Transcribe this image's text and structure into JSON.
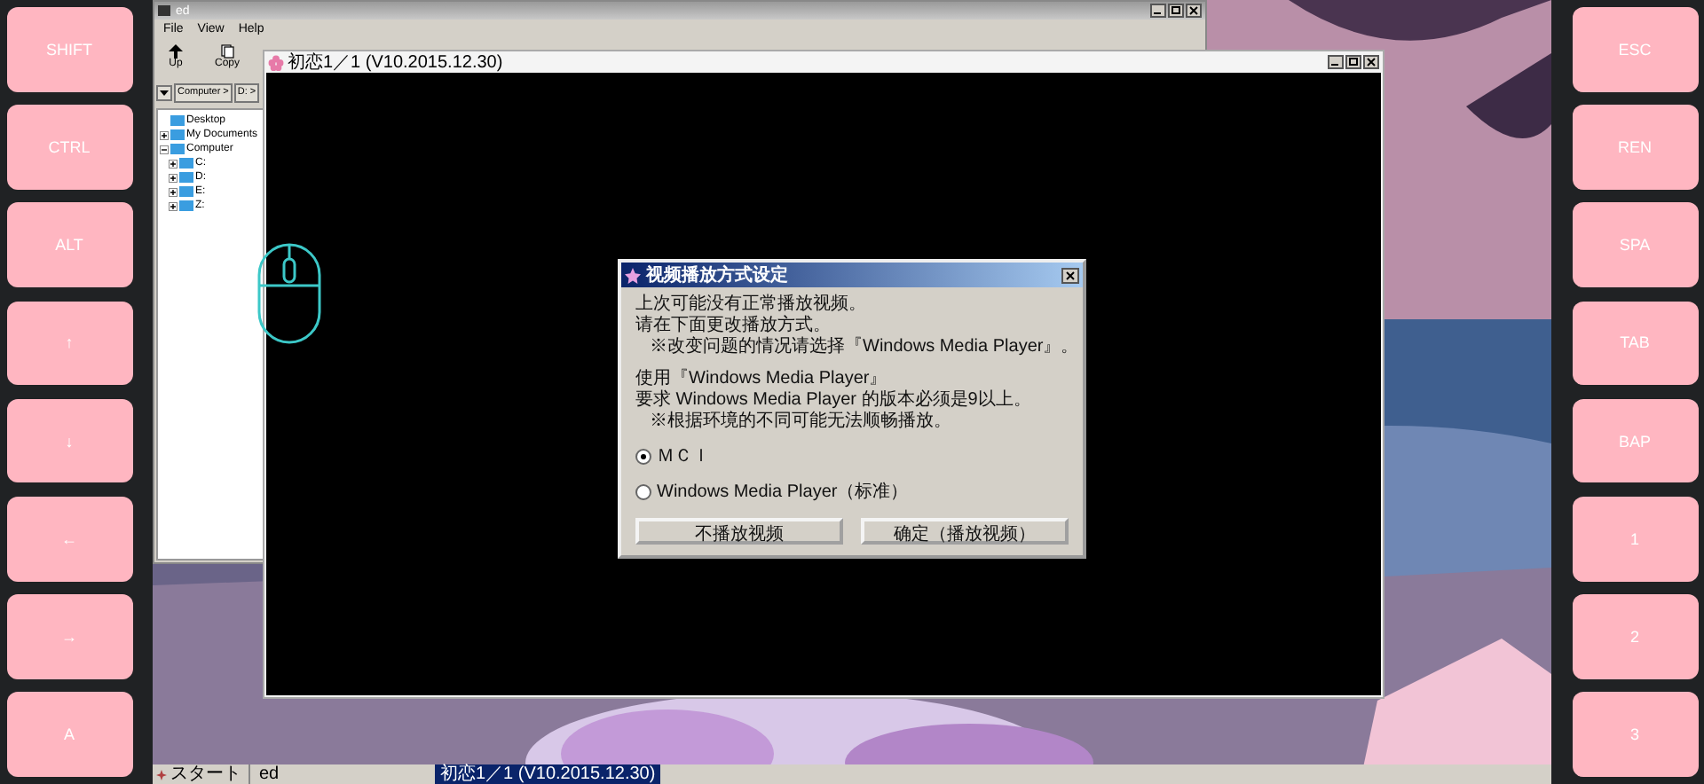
{
  "keys_left": [
    {
      "label": "SHIFT"
    },
    {
      "label": "CTRL"
    },
    {
      "label": "ALT"
    },
    {
      "label": "↑"
    },
    {
      "label": "↓"
    },
    {
      "label": "←"
    },
    {
      "label": "→"
    },
    {
      "label": "A"
    }
  ],
  "keys_right": [
    {
      "label": "ESC"
    },
    {
      "label": "REN"
    },
    {
      "label": "SPA"
    },
    {
      "label": "TAB"
    },
    {
      "label": "BAP"
    },
    {
      "label": "1"
    },
    {
      "label": "2"
    },
    {
      "label": "3"
    }
  ],
  "explorer": {
    "title": "ed",
    "menu": [
      "File",
      "View",
      "Help"
    ],
    "toolbar": [
      "Up",
      "Copy"
    ],
    "address": [
      "Computer >",
      "D: >"
    ],
    "tree": [
      {
        "label": "Desktop"
      },
      {
        "label": "My Documents",
        "expanded": false
      },
      {
        "label": "Computer",
        "expanded": true,
        "children": [
          {
            "label": "C:",
            "expanded": false
          },
          {
            "label": "D:",
            "expanded": false
          },
          {
            "label": "E:",
            "expanded": false
          },
          {
            "label": "Z:",
            "expanded": false
          }
        ]
      }
    ]
  },
  "game_window": {
    "title": "初恋1／1 (V10.2015.12.30)"
  },
  "dialog": {
    "title": "视频播放方式设定",
    "paragraphs": [
      [
        "上次可能没有正常播放视频。",
        "请在下面更改播放方式。",
        "※改变问题的情况请选择『Windows Media Player』。"
      ],
      [
        "使用『Windows Media Player』",
        "要求 Windows Media Player 的版本必须是9以上。",
        "※根据环境的不同可能无法顺畅播放。"
      ]
    ],
    "options": [
      {
        "label": "ＭＣＩ",
        "selected": true
      },
      {
        "label": "Windows Media Player（标准）",
        "selected": false
      }
    ],
    "buttons": [
      "不播放视频",
      "确定（播放视频）"
    ]
  },
  "taskbar": {
    "start": "スタート",
    "items": [
      {
        "label": "ed",
        "selected": false
      },
      {
        "label": "初恋1／1 (V10.2015.12.30)",
        "selected": true
      }
    ]
  }
}
